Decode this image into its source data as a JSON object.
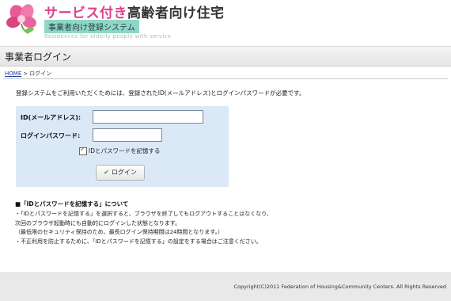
{
  "header": {
    "site_title_main": "サービス付き",
    "site_title_rest": "高齢者向け住宅",
    "system_label": "事業者向け登録システム",
    "site_subtitle": "Residences for elderly people with service"
  },
  "page": {
    "title": "事業者ログイン"
  },
  "breadcrumb": {
    "home": "HOME",
    "separator": ">",
    "current": "ログイン"
  },
  "intro_text": "登録システムをご利用いただくためには、登録されたID(メールアドレス)とログインパスワードが必要です。",
  "login_form": {
    "id_label": "ID(メールアドレス):",
    "id_value": "",
    "password_label": "ログインパスワード:",
    "password_value": "",
    "remember_label": "IDとパスワードを記憶する",
    "remember_checked": true,
    "login_button": "ログイン"
  },
  "notes": {
    "title": "■「IDとパスワードを記憶する」について",
    "lines": [
      "・「IDとパスワードを記憶する」を選択すると、ブラウザを終了してもログアウトすることはなくなり、",
      "次回のブラウザ起動時にも自動的にログインした状態となります。",
      "（最低限のセキュリティ保持のため、最長ログイン保持期間は24時間となります。）",
      "・不正利用を防止するために、「IDとパスワードを記憶する」の設定をする場合はご注意ください。"
    ]
  },
  "footer": {
    "copyright": "Copyright(C)2011 Federation of Housing&Community Centers. All Rights Reserved"
  },
  "colors": {
    "brand_pink": "#e0408a",
    "badge_teal": "#8fd6c8",
    "form_bg": "#dbe9f7",
    "link_blue": "#1a3fa0"
  },
  "icons": {
    "logo": "flower-logo-icon",
    "login_button_icon": "check-icon"
  }
}
